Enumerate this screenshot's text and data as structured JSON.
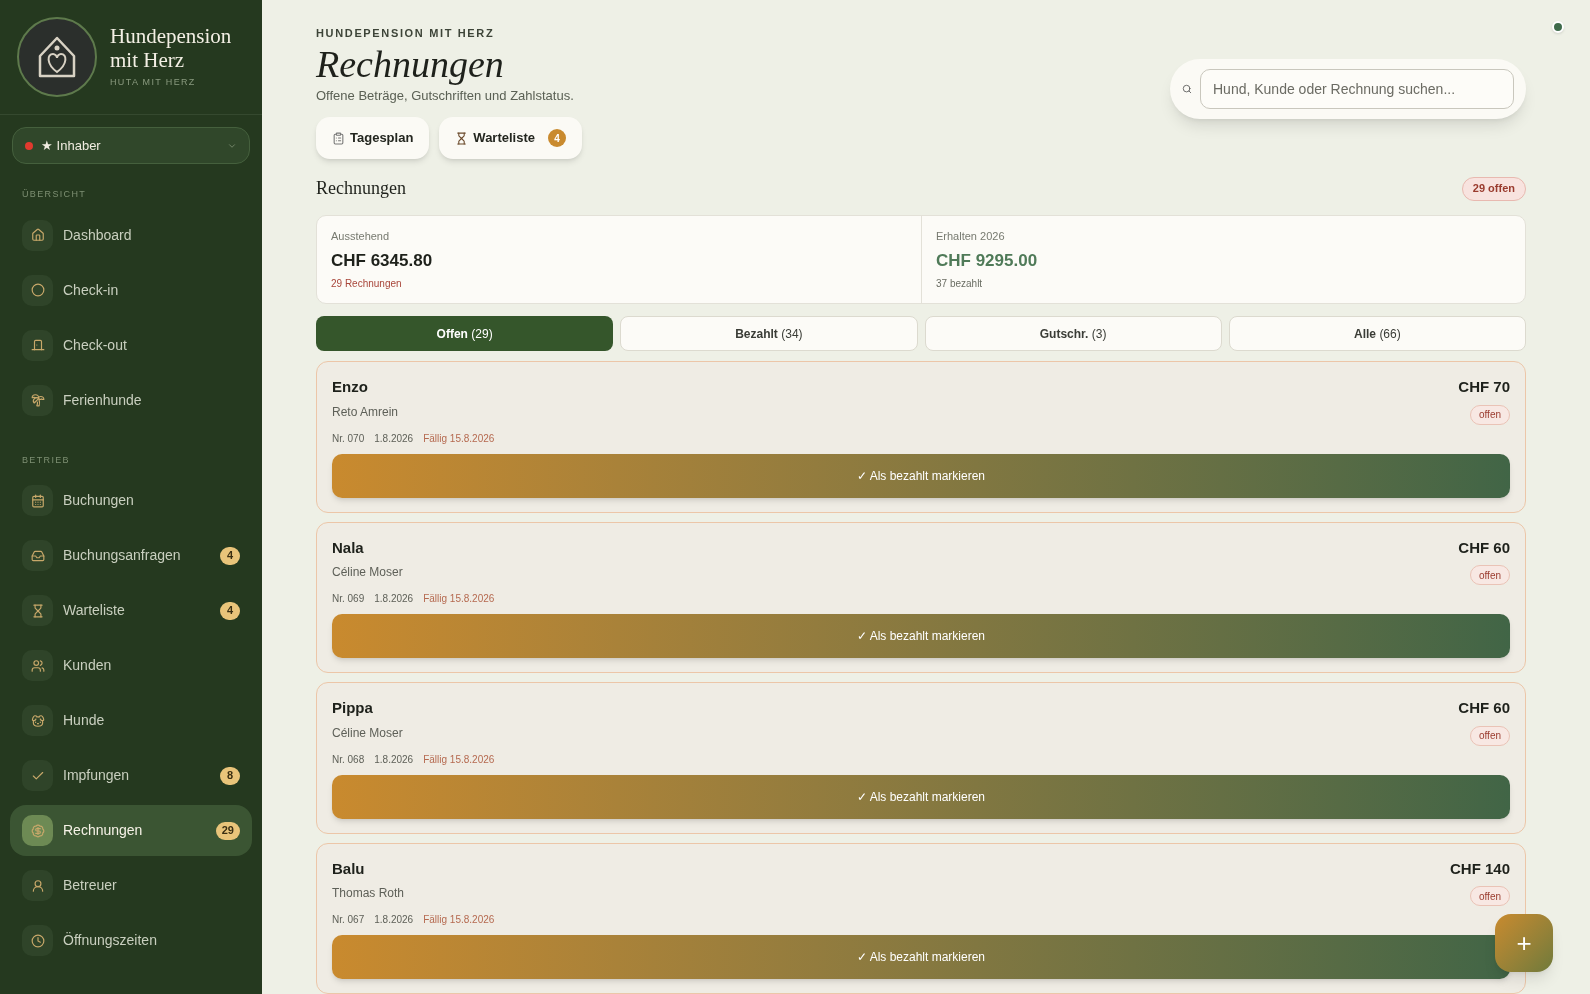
{
  "brand": {
    "name": "Hundepension mit Herz",
    "subtitle": "HUTA MIT HERZ"
  },
  "role": {
    "label": "★ Inhaber"
  },
  "nav_sections": [
    {
      "heading": "ÜBERSICHT",
      "items": [
        {
          "label": "Dashboard",
          "selected": false
        },
        {
          "label": "Check-in",
          "selected": false
        },
        {
          "label": "Check-out",
          "selected": false
        },
        {
          "label": "Ferienhunde",
          "selected": false
        }
      ]
    },
    {
      "heading": "BETRIEB",
      "items": [
        {
          "label": "Buchungen",
          "selected": false
        },
        {
          "label": "Buchungsanfragen",
          "badge": "4",
          "selected": false
        },
        {
          "label": "Warteliste",
          "badge": "4",
          "selected": false
        },
        {
          "label": "Kunden",
          "selected": false
        },
        {
          "label": "Hunde",
          "selected": false
        },
        {
          "label": "Impfungen",
          "badge": "8",
          "selected": false
        },
        {
          "label": "Rechnungen",
          "badge": "29",
          "selected": true
        },
        {
          "label": "Betreuer",
          "selected": false
        },
        {
          "label": "Öffnungszeiten",
          "selected": false
        }
      ]
    }
  ],
  "header": {
    "eyebrow": "HUNDEPENSION MIT HERZ",
    "title": "Rechnungen",
    "subtitle": "Offene Beträge, Gutschriften und Zahlstatus."
  },
  "quick_buttons": [
    {
      "label": "Tagesplan"
    },
    {
      "label": "Warteliste",
      "badge": "4"
    }
  ],
  "search": {
    "placeholder": "Hund, Kunde oder Rechnung suchen..."
  },
  "section": {
    "title": "Rechnungen",
    "badge": "29 offen"
  },
  "summary": [
    {
      "label": "Ausstehend",
      "value": "CHF 6345.80",
      "note": "29 Rechnungen",
      "kind": "outstanding"
    },
    {
      "label": "Erhalten 2026",
      "value": "CHF 9295.00",
      "note": "37 bezahlt",
      "kind": "received"
    }
  ],
  "filters": [
    {
      "label": "Offen",
      "count": "(29)",
      "selected": true
    },
    {
      "label": "Bezahlt",
      "count": "(34)",
      "selected": false
    },
    {
      "label": "Gutschr.",
      "count": "(3)",
      "selected": false
    },
    {
      "label": "Alle",
      "count": "(66)",
      "selected": false
    }
  ],
  "invoices": [
    {
      "dog": "Enzo",
      "owner": "Reto Amrein",
      "number": "Nr. 070",
      "date": "1.8.2026",
      "due": "Fällig 15.8.2026",
      "amount": "CHF 70",
      "status": "offen",
      "action": "✓ Als bezahlt markieren"
    },
    {
      "dog": "Nala",
      "owner": "Céline Moser",
      "number": "Nr. 069",
      "date": "1.8.2026",
      "due": "Fällig 15.8.2026",
      "amount": "CHF 60",
      "status": "offen",
      "action": "✓ Als bezahlt markieren"
    },
    {
      "dog": "Pippa",
      "owner": "Céline Moser",
      "number": "Nr. 068",
      "date": "1.8.2026",
      "due": "Fällig 15.8.2026",
      "amount": "CHF 60",
      "status": "offen",
      "action": "✓ Als bezahlt markieren"
    },
    {
      "dog": "Balu",
      "owner": "Thomas Roth",
      "number": "Nr. 067",
      "date": "1.8.2026",
      "due": "Fällig 15.8.2026",
      "amount": "CHF 140",
      "status": "offen",
      "action": "✓ Als bezahlt markieren"
    }
  ],
  "fab": {
    "label": "+"
  }
}
